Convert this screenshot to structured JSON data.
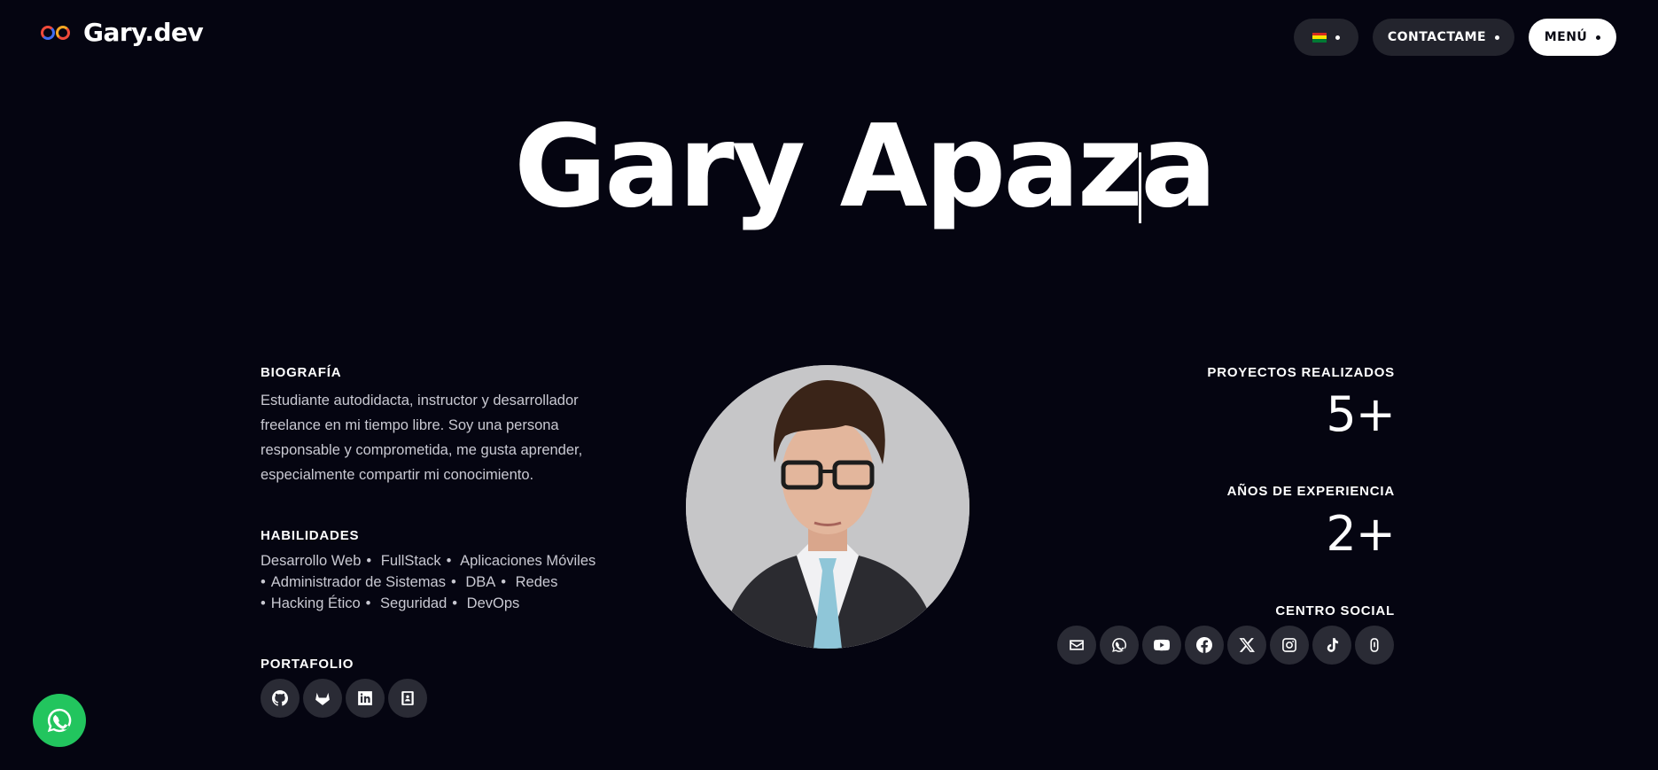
{
  "header": {
    "logo_text": "Gary.dev",
    "language_flag": "bolivia-flag-icon",
    "contact_label": "CONTACTAME",
    "menu_label": "MENÚ"
  },
  "hero": {
    "name": "Gary Apaza"
  },
  "biography": {
    "title": "BIOGRAFÍA",
    "text": "Estudiante autodidacta, instructor y desarrollador freelance en mi tiempo libre. Soy una persona responsable y comprometida, me gusta aprender, especialmente compartir mi conocimiento."
  },
  "skills": {
    "title": "HABILIDADES",
    "items": [
      "Desarrollo Web",
      "FullStack",
      "Aplicaciones Móviles",
      "Administrador de Sistemas",
      "DBA",
      "Redes",
      "Hacking Ético",
      "Seguridad",
      "DevOps"
    ]
  },
  "portfolio": {
    "title": "PORTAFOLIO",
    "icons": [
      "github-icon",
      "gitlab-icon",
      "linkedin-icon",
      "contact-card-icon"
    ]
  },
  "stats": {
    "projects_title": "PROYECTOS REALIZADOS",
    "projects_value": "5+",
    "experience_title": "AÑOS DE EXPERIENCIA",
    "experience_value": "2+",
    "social_title": "CENTRO SOCIAL"
  },
  "social_icons": [
    "mail-icon",
    "whatsapp-icon",
    "youtube-icon",
    "facebook-icon",
    "x-icon",
    "instagram-icon",
    "tiktok-icon",
    "threads-icon"
  ],
  "colors": {
    "background": "#050511",
    "button_dark": "#23242d",
    "icon_circle": "#2a2b35",
    "whatsapp_green": "#22c55e"
  }
}
